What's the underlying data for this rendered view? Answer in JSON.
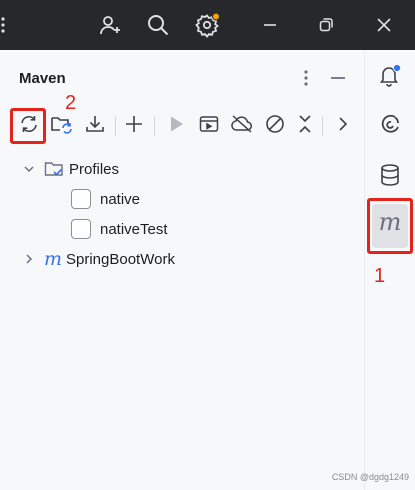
{
  "panel": {
    "title": "Maven"
  },
  "tree": {
    "profiles_label": "Profiles",
    "profiles": [
      {
        "label": "native",
        "checked": false
      },
      {
        "label": "nativeTest",
        "checked": false
      }
    ],
    "project_label": "SpringBootWork",
    "project_icon_letter": "m"
  },
  "strip": {
    "maven_letter": "m"
  },
  "annotations": {
    "label_1": "1",
    "label_2": "2"
  },
  "watermark": "CSDN @dgdg1249",
  "colors": {
    "titlebar": "#27282c",
    "accent_blue": "#3574f0",
    "notify_dot": "#f0a30a",
    "annotation_red": "#e5231b"
  },
  "icons": {
    "titlebar": [
      "menu-dots-icon",
      "add-user-icon",
      "search-icon",
      "gear-icon",
      "minimize-icon",
      "restore-icon",
      "close-icon"
    ],
    "toolbar": [
      "reload-icon",
      "reimport-folder-icon",
      "download-icon",
      "add-icon",
      "run-icon",
      "execute-goal-icon",
      "offline-cloud-icon",
      "skip-tests-icon",
      "collapse-all-icon",
      "more-icon"
    ],
    "strip": [
      "notifications-bell-icon",
      "ai-assistant-icon",
      "database-icon",
      "maven-icon"
    ]
  }
}
